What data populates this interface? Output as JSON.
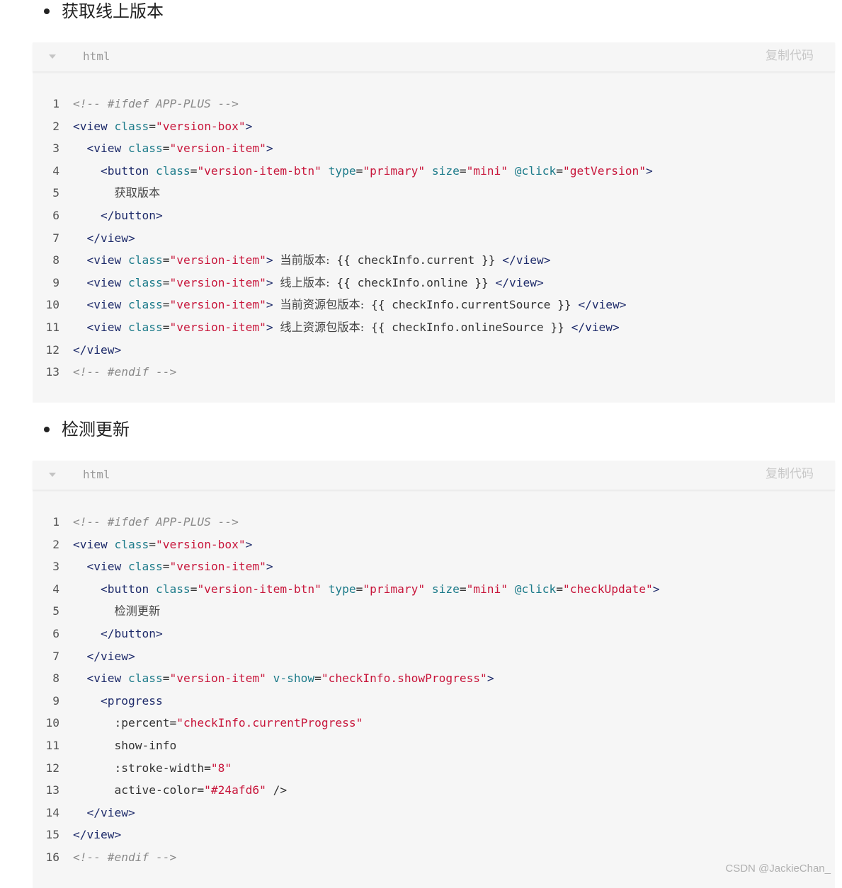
{
  "sections": [
    {
      "heading": "获取线上版本",
      "lang": "html",
      "copy_label": "复制代码",
      "lines": [
        [
          [
            "comment",
            "<!-- #ifdef APP-PLUS -->"
          ]
        ],
        [
          [
            "tag",
            "<view "
          ],
          [
            "attr",
            "class"
          ],
          [
            "text",
            "="
          ],
          [
            "str",
            "\"version-box\""
          ],
          [
            "tag",
            ">"
          ]
        ],
        [
          [
            "text",
            "  "
          ],
          [
            "tag",
            "<view "
          ],
          [
            "attr",
            "class"
          ],
          [
            "text",
            "="
          ],
          [
            "str",
            "\"version-item\""
          ],
          [
            "tag",
            ">"
          ]
        ],
        [
          [
            "text",
            "    "
          ],
          [
            "tag",
            "<button "
          ],
          [
            "attr",
            "class"
          ],
          [
            "text",
            "="
          ],
          [
            "str",
            "\"version-item-btn\""
          ],
          [
            "text",
            " "
          ],
          [
            "attr",
            "type"
          ],
          [
            "text",
            "="
          ],
          [
            "str",
            "\"primary\""
          ],
          [
            "text",
            " "
          ],
          [
            "attr",
            "size"
          ],
          [
            "text",
            "="
          ],
          [
            "str",
            "\"mini\""
          ],
          [
            "text",
            " "
          ],
          [
            "attr",
            "@click"
          ],
          [
            "text",
            "="
          ],
          [
            "str",
            "\"getVersion\""
          ],
          [
            "tag",
            ">"
          ]
        ],
        [
          [
            "text",
            "      "
          ],
          [
            "cjk",
            "获取版本"
          ]
        ],
        [
          [
            "text",
            "    "
          ],
          [
            "tag",
            "</button>"
          ]
        ],
        [
          [
            "text",
            "  "
          ],
          [
            "tag",
            "</view>"
          ]
        ],
        [
          [
            "text",
            "  "
          ],
          [
            "tag",
            "<view "
          ],
          [
            "attr",
            "class"
          ],
          [
            "text",
            "="
          ],
          [
            "str",
            "\"version-item\""
          ],
          [
            "tag",
            ">"
          ],
          [
            "text",
            " "
          ],
          [
            "cjk",
            "当前版本:"
          ],
          [
            "text",
            " {{ checkInfo.current }} "
          ],
          [
            "tag",
            "</view>"
          ]
        ],
        [
          [
            "text",
            "  "
          ],
          [
            "tag",
            "<view "
          ],
          [
            "attr",
            "class"
          ],
          [
            "text",
            "="
          ],
          [
            "str",
            "\"version-item\""
          ],
          [
            "tag",
            ">"
          ],
          [
            "text",
            " "
          ],
          [
            "cjk",
            "线上版本:"
          ],
          [
            "text",
            " {{ checkInfo.online }} "
          ],
          [
            "tag",
            "</view>"
          ]
        ],
        [
          [
            "text",
            "  "
          ],
          [
            "tag",
            "<view "
          ],
          [
            "attr",
            "class"
          ],
          [
            "text",
            "="
          ],
          [
            "str",
            "\"version-item\""
          ],
          [
            "tag",
            ">"
          ],
          [
            "text",
            " "
          ],
          [
            "cjk",
            "当前资源包版本:"
          ],
          [
            "text",
            " {{ checkInfo.currentSource }} "
          ],
          [
            "tag",
            "</view>"
          ]
        ],
        [
          [
            "text",
            "  "
          ],
          [
            "tag",
            "<view "
          ],
          [
            "attr",
            "class"
          ],
          [
            "text",
            "="
          ],
          [
            "str",
            "\"version-item\""
          ],
          [
            "tag",
            ">"
          ],
          [
            "text",
            " "
          ],
          [
            "cjk",
            "线上资源包版本:"
          ],
          [
            "text",
            " {{ checkInfo.onlineSource }} "
          ],
          [
            "tag",
            "</view>"
          ]
        ],
        [
          [
            "tag",
            "</view>"
          ]
        ],
        [
          [
            "comment",
            "<!-- #endif -->"
          ]
        ]
      ]
    },
    {
      "heading": "检测更新",
      "lang": "html",
      "copy_label": "复制代码",
      "lines": [
        [
          [
            "comment",
            "<!-- #ifdef APP-PLUS -->"
          ]
        ],
        [
          [
            "tag",
            "<view "
          ],
          [
            "attr",
            "class"
          ],
          [
            "text",
            "="
          ],
          [
            "str",
            "\"version-box\""
          ],
          [
            "tag",
            ">"
          ]
        ],
        [
          [
            "text",
            "  "
          ],
          [
            "tag",
            "<view "
          ],
          [
            "attr",
            "class"
          ],
          [
            "text",
            "="
          ],
          [
            "str",
            "\"version-item\""
          ],
          [
            "tag",
            ">"
          ]
        ],
        [
          [
            "text",
            "    "
          ],
          [
            "tag",
            "<button "
          ],
          [
            "attr",
            "class"
          ],
          [
            "text",
            "="
          ],
          [
            "str",
            "\"version-item-btn\""
          ],
          [
            "text",
            " "
          ],
          [
            "attr",
            "type"
          ],
          [
            "text",
            "="
          ],
          [
            "str",
            "\"primary\""
          ],
          [
            "text",
            " "
          ],
          [
            "attr",
            "size"
          ],
          [
            "text",
            "="
          ],
          [
            "str",
            "\"mini\""
          ],
          [
            "text",
            " "
          ],
          [
            "attr",
            "@click"
          ],
          [
            "text",
            "="
          ],
          [
            "str",
            "\"checkUpdate\""
          ],
          [
            "tag",
            ">"
          ]
        ],
        [
          [
            "text",
            "      "
          ],
          [
            "cjk",
            "检测更新"
          ]
        ],
        [
          [
            "text",
            "    "
          ],
          [
            "tag",
            "</button>"
          ]
        ],
        [
          [
            "text",
            "  "
          ],
          [
            "tag",
            "</view>"
          ]
        ],
        [
          [
            "text",
            "  "
          ],
          [
            "tag",
            "<view "
          ],
          [
            "attr",
            "class"
          ],
          [
            "text",
            "="
          ],
          [
            "str",
            "\"version-item\""
          ],
          [
            "text",
            " "
          ],
          [
            "attr",
            "v-show"
          ],
          [
            "text",
            "="
          ],
          [
            "str",
            "\"checkInfo.showProgress\""
          ],
          [
            "tag",
            ">"
          ]
        ],
        [
          [
            "text",
            "    "
          ],
          [
            "tag",
            "<progress"
          ]
        ],
        [
          [
            "text",
            "      :percent="
          ],
          [
            "str",
            "\"checkInfo.currentProgress\""
          ]
        ],
        [
          [
            "text",
            "      show-info"
          ]
        ],
        [
          [
            "text",
            "      :stroke-width="
          ],
          [
            "str",
            "\"8\""
          ]
        ],
        [
          [
            "text",
            "      active-color="
          ],
          [
            "str",
            "\"#24afd6\""
          ],
          [
            "text",
            " />"
          ]
        ],
        [
          [
            "text",
            "  "
          ],
          [
            "tag",
            "</view>"
          ]
        ],
        [
          [
            "tag",
            "</view>"
          ]
        ],
        [
          [
            "comment",
            "<!-- #endif -->"
          ]
        ]
      ]
    }
  ],
  "watermark": "CSDN @JackieChan_",
  "colors": {
    "tag": "#1f2c6b",
    "attr": "#1d7b8a",
    "string": "#c8163b",
    "comment": "#8a8a8a",
    "block_bg": "#f6f6f6"
  }
}
